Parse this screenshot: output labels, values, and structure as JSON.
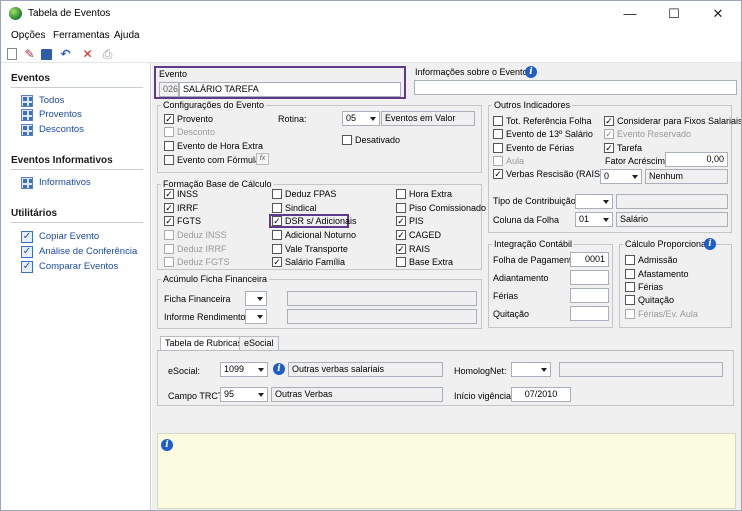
{
  "window": {
    "title": "Tabela de Eventos",
    "minimize": "—",
    "maximize": "☐",
    "close": "✕"
  },
  "menu": [
    "Opções",
    "Ferramentas",
    "Ajuda"
  ],
  "sidebar": {
    "eventos": {
      "title": "Eventos",
      "items": [
        "Todos",
        "Proventos",
        "Descontos"
      ]
    },
    "informativos": {
      "title": "Eventos Informativos",
      "items": [
        "Informativos"
      ]
    },
    "utilitarios": {
      "title": "Utilitários",
      "items": [
        "Copiar Evento",
        "Análise de Conferência",
        "Comparar Eventos"
      ]
    }
  },
  "evento": {
    "label": "Evento",
    "code": "026",
    "name": "SALÁRIO TAREFA"
  },
  "info_sobre": {
    "label": "Informações sobre o Evento"
  },
  "config": {
    "title": "Configurações do Evento",
    "provento": "Provento",
    "desconto": "Desconto",
    "hora_extra": "Evento de Hora Extra",
    "formula": "Evento com Fórmula",
    "fx": "fx",
    "rotina_label": "Rotina:",
    "rotina_value": "05",
    "rotina_desc": "Eventos em Valor",
    "desativado": "Desativado"
  },
  "formacao": {
    "title": "Formação Base de Cálculo",
    "col1": [
      {
        "label": "INSS",
        "checked": true,
        "disabled": false
      },
      {
        "label": "IRRF",
        "checked": true,
        "disabled": false
      },
      {
        "label": "FGTS",
        "checked": true,
        "disabled": false
      },
      {
        "label": "Deduz INSS",
        "checked": false,
        "disabled": true
      },
      {
        "label": "Deduz IRRF",
        "checked": false,
        "disabled": true
      },
      {
        "label": "Deduz FGTS",
        "checked": false,
        "disabled": true
      }
    ],
    "col2": [
      {
        "label": "Deduz FPAS",
        "checked": false,
        "disabled": false
      },
      {
        "label": "Sindical",
        "checked": false,
        "disabled": false
      },
      {
        "label": "DSR s/ Adicionais",
        "checked": true,
        "disabled": false
      },
      {
        "label": "Adicional Noturno",
        "checked": false,
        "disabled": false
      },
      {
        "label": "Vale Transporte",
        "checked": false,
        "disabled": false
      },
      {
        "label": "Salário Família",
        "checked": true,
        "disabled": false
      }
    ],
    "col3": [
      {
        "label": "Hora Extra",
        "checked": false,
        "disabled": false
      },
      {
        "label": "Piso Comissionado",
        "checked": false,
        "disabled": false
      },
      {
        "label": "PIS",
        "checked": true,
        "disabled": false
      },
      {
        "label": "CAGED",
        "checked": true,
        "disabled": false
      },
      {
        "label": "RAIS",
        "checked": true,
        "disabled": false
      },
      {
        "label": "Base Extra",
        "checked": false,
        "disabled": false
      }
    ]
  },
  "acumulo": {
    "title": "Acúmulo Ficha Financeira",
    "ficha": "Ficha Financeira",
    "informe": "Informe Rendimentos"
  },
  "outros": {
    "title": "Outros Indicadores",
    "tot_ref": "Tot. Referência Folha",
    "decimo": "Evento de 13º Salário",
    "ferias": "Evento de Férias",
    "aula": "Aula",
    "verbas": "Verbas Rescisão (RAIS)",
    "considerar": "Considerar para Fixos Salariais",
    "reservado": "Evento Reservado",
    "tarefa": "Tarefa",
    "fator_label": "Fator Acréscimo",
    "fator_value": "0,00",
    "verbas_value": "0",
    "verbas_desc": "Nenhum",
    "tipo_contrib": "Tipo de Contribuição",
    "coluna_label": "Coluna da Folha",
    "coluna_value": "01",
    "coluna_desc": "Salário"
  },
  "integracao": {
    "title": "Integração Contábil",
    "folha": "Folha de Pagamento",
    "folha_value": "0001",
    "adiantamento": "Adiantamento",
    "ferias": "Férias",
    "quitacao": "Quitação"
  },
  "calculo": {
    "title": "Cálculo Proporcional",
    "items": [
      "Admissão",
      "Afastamento",
      "Férias",
      "Quitação",
      "Férias/Ev. Aula"
    ]
  },
  "tabs": [
    "Tabela de Rubricas",
    "eSocial"
  ],
  "rubricas": {
    "esocial_label": "eSocial:",
    "esocial_code": "1099",
    "esocial_desc": "Outras verbas salariais",
    "homolog_label": "HomologNet:",
    "trct_label": "Campo TRCT:",
    "trct_code": "95",
    "trct_desc": "Outras Verbas",
    "vigencia_label": "Início vigência:",
    "vigencia_value": "07/2010"
  },
  "colors": {
    "highlight": "#5e3a8c",
    "info_panel": "#fbfbe0",
    "link": "#1f4aa8"
  }
}
